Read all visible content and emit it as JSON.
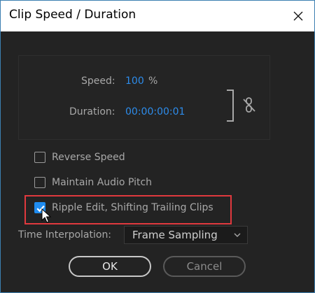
{
  "window": {
    "title": "Clip Speed / Duration",
    "close_icon": "close-icon"
  },
  "speed": {
    "label": "Speed:",
    "value": "100",
    "unit": "%"
  },
  "duration": {
    "label": "Duration:",
    "value": "00:00:00:01"
  },
  "link_toggle": {
    "icon": "unlink-icon",
    "state": "unlinked"
  },
  "options": {
    "reverse_speed": {
      "label": "Reverse Speed",
      "checked": false
    },
    "maintain_audio_pitch": {
      "label": "Maintain Audio Pitch",
      "checked": false
    },
    "ripple_edit": {
      "label": "Ripple Edit, Shifting Trailing Clips",
      "checked": true
    }
  },
  "time_interpolation": {
    "label": "Time Interpolation:",
    "selected": "Frame Sampling"
  },
  "buttons": {
    "ok": "OK",
    "cancel": "Cancel"
  },
  "colors": {
    "accent": "#2d8ceb",
    "highlight": "#e0393e",
    "background": "#232323"
  }
}
